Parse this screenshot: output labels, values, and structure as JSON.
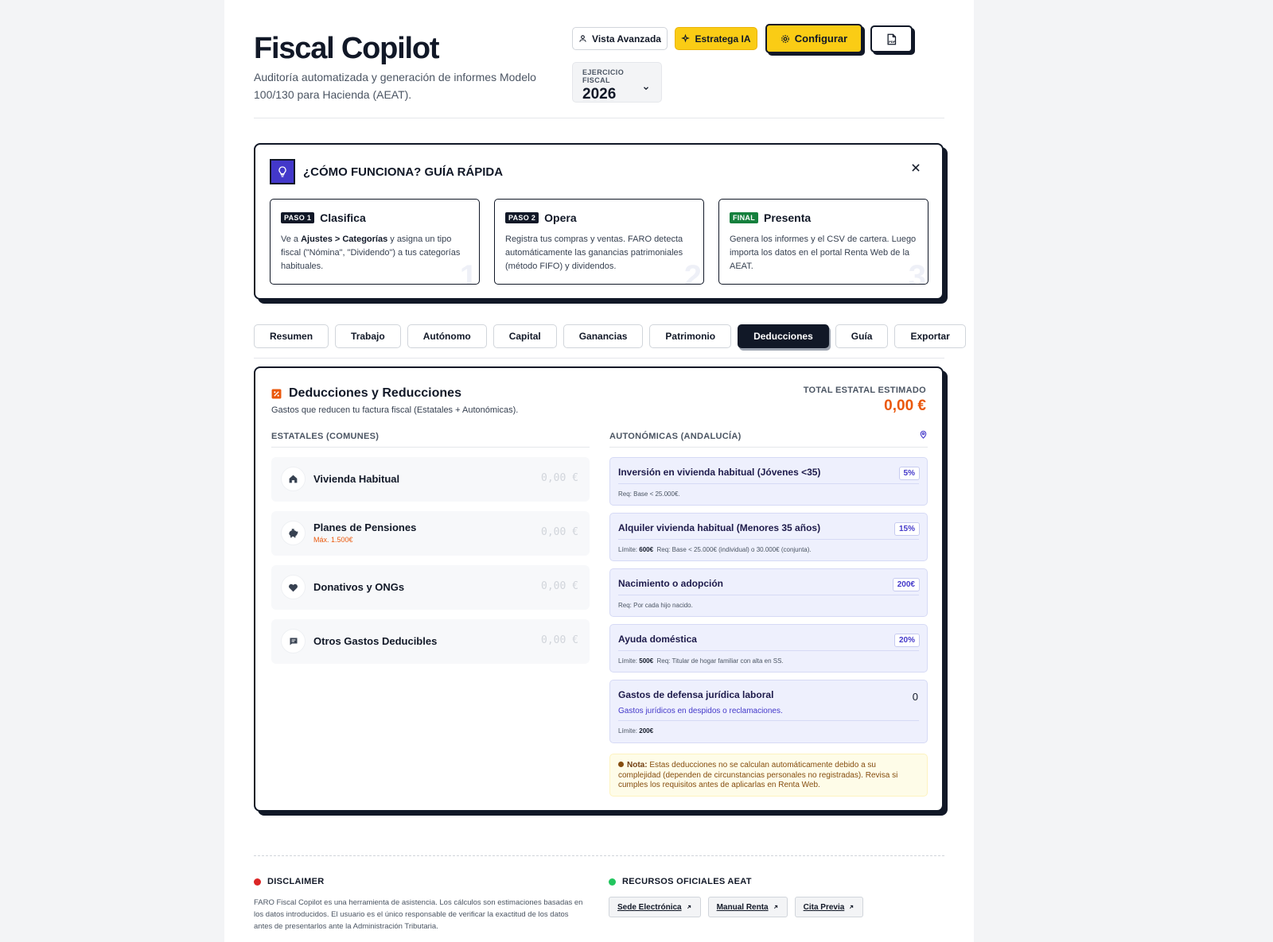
{
  "header": {
    "title": "Fiscal Copilot",
    "subtitle": "Auditoría automatizada y generación de informes Modelo 100/130 para Hacienda (AEAT).",
    "buttons": {
      "advanced": "Vista Avanzada",
      "ia": "Estratega IA",
      "config": "Configurar"
    },
    "fiscal_year": {
      "label": "EJERCICIO FISCAL",
      "value": "2026"
    }
  },
  "guide": {
    "title": "¿CÓMO FUNCIONA? GUÍA RÁPIDA",
    "steps": [
      {
        "tag": "PASO 1",
        "title": "Clasifica",
        "text_pre": "Ve a ",
        "text_bold": "Ajustes > Categorías",
        "text_post": " y asigna un tipo fiscal (\"Nómina\", \"Dividendo\") a tus categorías habituales.",
        "num": "1"
      },
      {
        "tag": "PASO 2",
        "title": "Opera",
        "text": "Registra tus compras y ventas. FARO detecta automáticamente las ganancias patrimoniales (método FIFO) y dividendos.",
        "num": "2"
      },
      {
        "tag": "FINAL",
        "title": "Presenta",
        "text": "Genera los informes y el CSV de cartera. Luego importa los datos en el portal Renta Web de la AEAT.",
        "num": "3"
      }
    ]
  },
  "tabs": [
    "Resumen",
    "Trabajo",
    "Autónomo",
    "Capital",
    "Ganancias",
    "Patrimonio",
    "Deducciones",
    "Guía",
    "Exportar"
  ],
  "active_tab": "Deducciones",
  "deductions": {
    "title": "Deducciones y Reducciones",
    "subtitle": "Gastos que reducen tu factura fiscal (Estatales + Autonómicas).",
    "total_label": "TOTAL ESTATAL ESTIMADO",
    "total_value": "0,00 €",
    "state_header": "ESTATALES (COMUNES)",
    "regional_header": "AUTONÓMICAS (ANDALUCÍA)",
    "state_items": [
      {
        "name": "Vivienda Habitual",
        "value": "0,00 €",
        "icon": "home-icon"
      },
      {
        "name": "Planes de Pensiones",
        "note": "Máx. 1.500€",
        "value": "0,00 €",
        "icon": "piggy-bank-icon"
      },
      {
        "name": "Donativos y ONGs",
        "value": "0,00 €",
        "icon": "heart-icon"
      },
      {
        "name": "Otros Gastos Deducibles",
        "value": "0,00 €",
        "icon": "receipt-icon"
      }
    ],
    "regional_items": [
      {
        "name": "Inversión en vivienda habitual (Jóvenes <35)",
        "badge": "5%",
        "req": "Req: Base < 25.000€."
      },
      {
        "name": "Alquiler vivienda habitual (Menores 35 años)",
        "badge": "15%",
        "limit_label": "Límite:",
        "limit_value": "600€",
        "req": "Req: Base < 25.000€ (individual) o 30.000€ (conjunta)."
      },
      {
        "name": "Nacimiento o adopción",
        "badge": "200€",
        "req": "Req: Por cada hijo nacido."
      },
      {
        "name": "Ayuda doméstica",
        "badge": "20%",
        "limit_label": "Límite:",
        "limit_value": "500€",
        "req": "Req: Titular de hogar familiar con alta en SS."
      },
      {
        "name": "Gastos de defensa jurídica laboral",
        "value": "0",
        "desc": "Gastos jurídicos en despidos o reclamaciones.",
        "limit_label": "Límite:",
        "limit_value": "200€"
      }
    ],
    "note_label": "Nota:",
    "note_text": " Estas deducciones no se calculan automáticamente debido a su complejidad (dependen de circunstancias personales no registradas). Revisa si cumples los requisitos antes de aplicarlas en Renta Web."
  },
  "footer": {
    "disclaimer_title": "DISCLAIMER",
    "disclaimer_text": "FARO Fiscal Copilot es una herramienta de asistencia. Los cálculos son estimaciones basadas en los datos introducidos. El usuario es el único responsable de verificar la exactitud de los datos antes de presentarlos ante la Administración Tributaria.",
    "resources_title": "RECURSOS OFICIALES AEAT",
    "links": [
      "Sede Electrónica",
      "Manual Renta",
      "Cita Previa"
    ]
  },
  "colors": {
    "accent_yellow": "#facc15",
    "primary_dark": "#111827",
    "indigo": "#4338ca",
    "orange": "#ea580c",
    "success_green": "#22c55e",
    "danger_red": "#dc2626"
  }
}
